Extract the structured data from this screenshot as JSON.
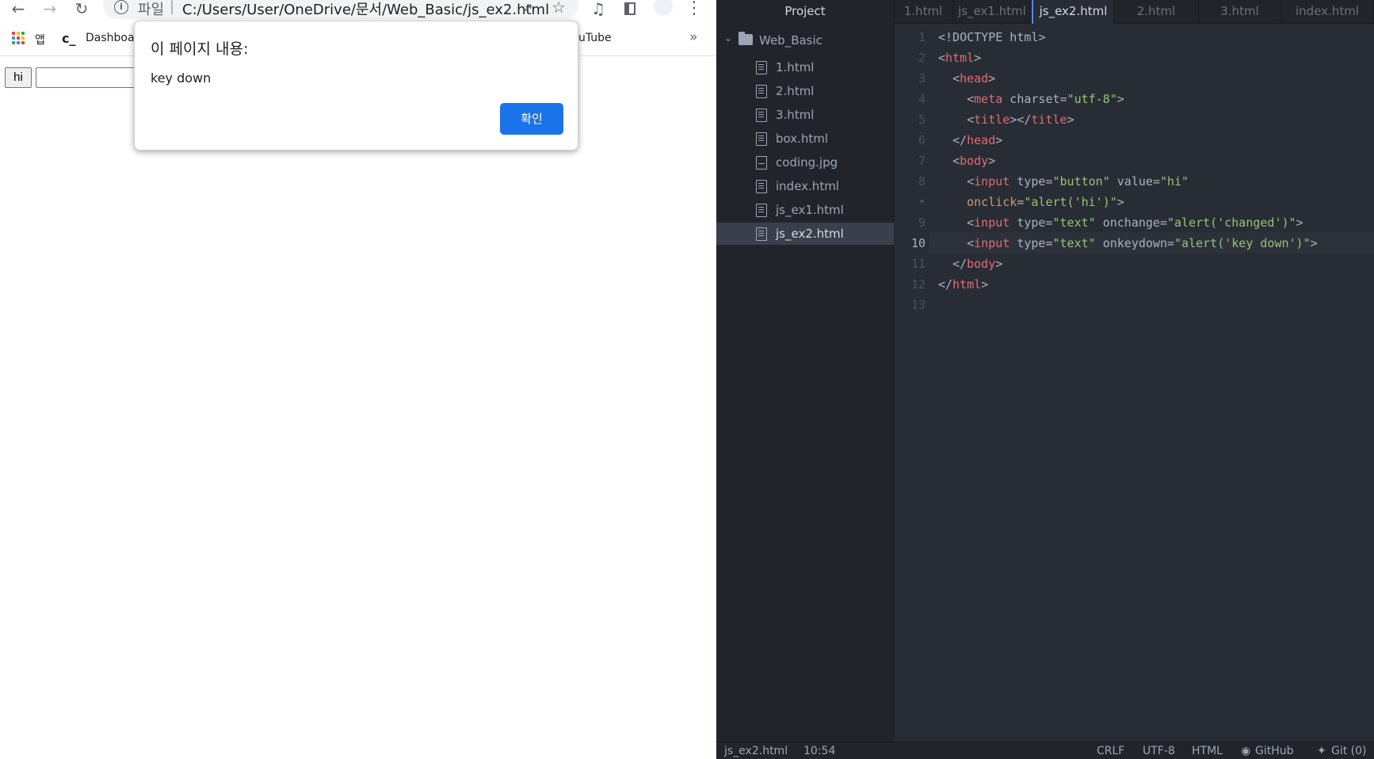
{
  "browser": {
    "url_scheme": "파일",
    "url": "C:/Users/User/OneDrive/문서/Web_Basic/js_ex2.html",
    "bookmarks": {
      "apps_label": "앱",
      "dashboard_label": "Dashboar",
      "youtube_label": "uTube",
      "more_label": "»"
    },
    "page": {
      "button_value": "hi"
    },
    "alert": {
      "title": "이 페이지 내용:",
      "message": "key down",
      "ok_label": "확인"
    }
  },
  "editor": {
    "tree": {
      "header": "Project",
      "root": "Web_Basic",
      "files": [
        {
          "name": "1.html",
          "icon": "file-icon"
        },
        {
          "name": "2.html",
          "icon": "file-icon"
        },
        {
          "name": "3.html",
          "icon": "file-icon"
        },
        {
          "name": "box.html",
          "icon": "file-icon"
        },
        {
          "name": "coding.jpg",
          "icon": "image-icon"
        },
        {
          "name": "index.html",
          "icon": "file-icon"
        },
        {
          "name": "js_ex1.html",
          "icon": "file-icon"
        },
        {
          "name": "js_ex2.html",
          "icon": "file-icon"
        }
      ],
      "selected": "js_ex2.html"
    },
    "tabs": [
      "1.html",
      "js_ex1.html",
      "js_ex2.html",
      "2.html",
      "3.html",
      "index.html"
    ],
    "active_tab": "js_ex2.html",
    "line_numbers": [
      "1",
      "2",
      "3",
      "4",
      "5",
      "6",
      "7",
      "8",
      "•",
      "9",
      "10",
      "11",
      "12",
      "13"
    ],
    "current_line": "10",
    "code_lines": [
      "<!DOCTYPE html>",
      "<html>",
      "  <head>",
      "    <meta charset=\"utf-8\">",
      "    <title></title>",
      "  </head>",
      "  <body>",
      "    <input type=\"button\" value=\"hi\"",
      "    onclick=\"alert('hi')\">",
      "    <input type=\"text\" onchange=\"alert('changed')\">",
      "    <input type=\"text\" onkeydown=\"alert('key down')\">",
      "  </body>",
      "</html>",
      ""
    ],
    "status": {
      "file": "js_ex2.html",
      "cursor": "10:54",
      "line_ending": "CRLF",
      "encoding": "UTF-8",
      "grammar": "HTML",
      "github": "GitHub",
      "git": "Git (0)"
    }
  },
  "colors": {
    "tag": "#e06c75",
    "attr": "#d19a66",
    "string": "#98c379",
    "punct": "#abb2bf",
    "accent": "#1a73e8"
  }
}
